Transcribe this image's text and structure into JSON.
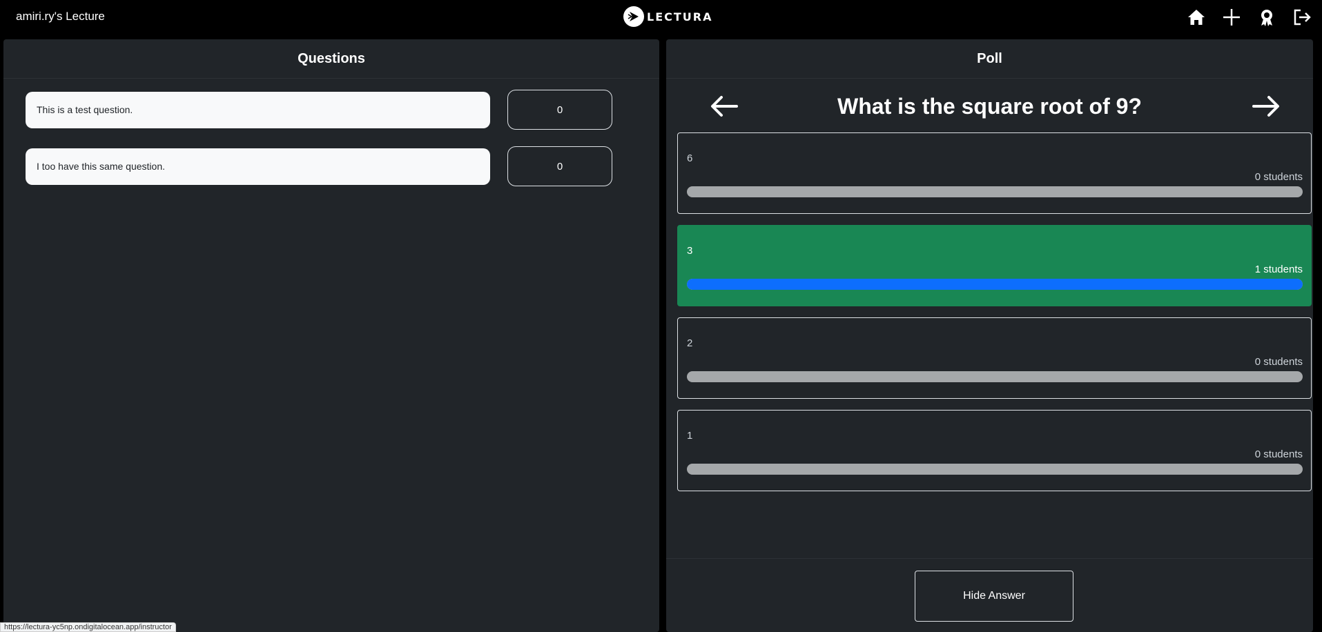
{
  "header": {
    "lecture_title": "amiri.ry's Lecture",
    "logo_text": "LECTURA",
    "icons": [
      "home-icon",
      "plus-icon",
      "award-icon",
      "logout-icon"
    ]
  },
  "questions_panel": {
    "title": "Questions",
    "questions": [
      {
        "text": "This is a test question.",
        "votes": "0"
      },
      {
        "text": "I too have this same question.",
        "votes": "0"
      }
    ]
  },
  "poll_panel": {
    "title": "Poll",
    "question": "What is the square root of 9?",
    "options": [
      {
        "label": "6",
        "count": "0 students",
        "fill": 0,
        "correct": false
      },
      {
        "label": "3",
        "count": "1 students",
        "fill": 1,
        "correct": true
      },
      {
        "label": "2",
        "count": "0 students",
        "fill": 0,
        "correct": false
      },
      {
        "label": "1",
        "count": "0 students",
        "fill": 0,
        "correct": false
      }
    ],
    "hide_answer_label": "Hide Answer"
  },
  "status_bar": {
    "url": "https://lectura-yc5np.ondigitalocean.app/instructor"
  },
  "colors": {
    "background": "#000000",
    "panel": "#212529",
    "correct": "#198754",
    "bar_fill": "#0d6efd",
    "bar_track": "#a5a8aa"
  }
}
